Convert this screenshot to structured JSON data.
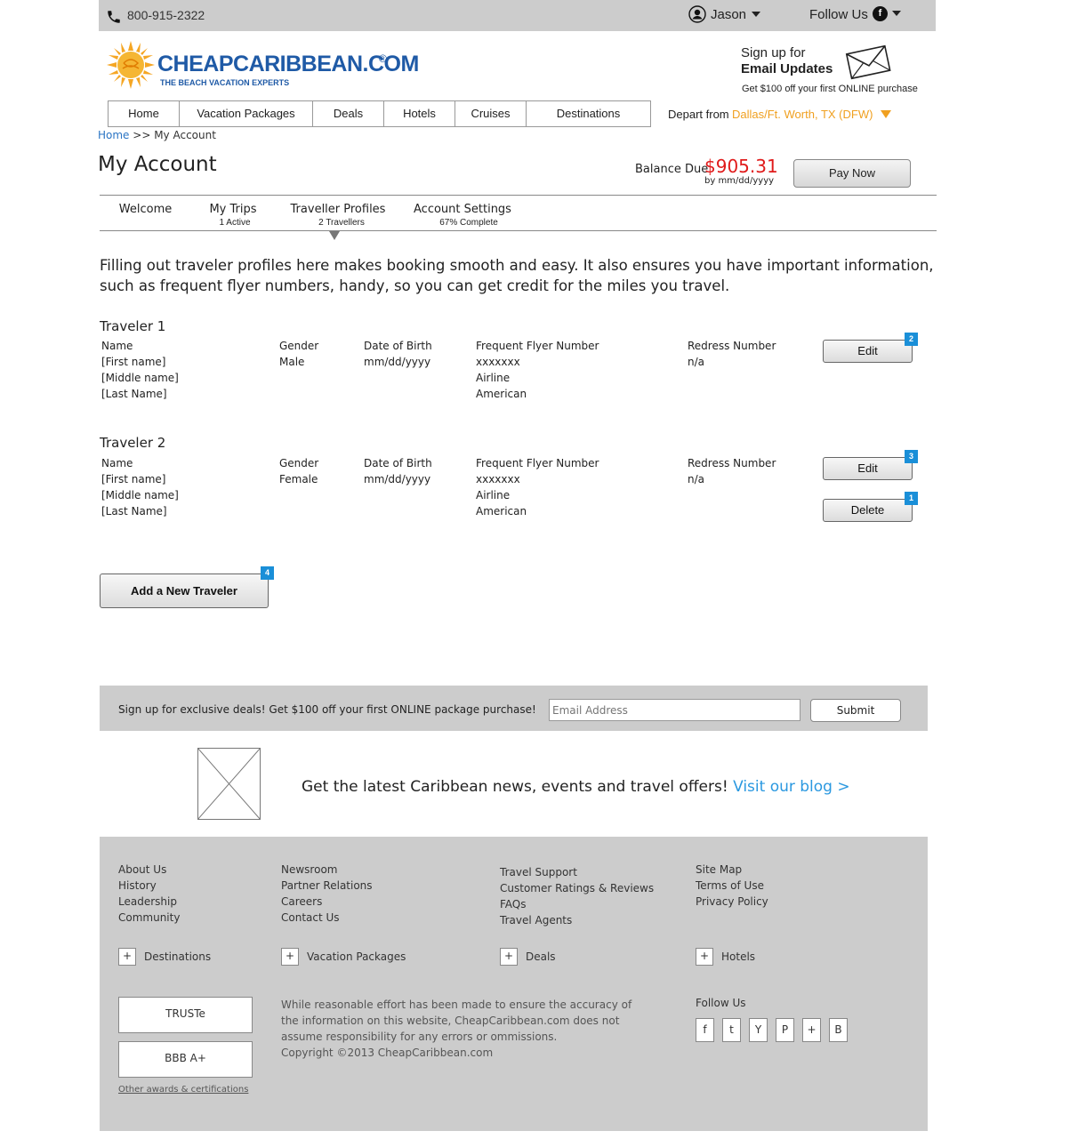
{
  "topbar": {
    "phone": "800-915-2322",
    "user_name": "Jason",
    "follow_label": "Follow Us"
  },
  "logo": {
    "name": "CHEAPCARIBBEAN.COM",
    "registered": "®",
    "tagline": "THE BEACH VACATION EXPERTS"
  },
  "email_promo": {
    "line1": "Sign up for",
    "line2": "Email Updates",
    "sub": "Get $100 off your first ONLINE purchase"
  },
  "nav": {
    "items": [
      "Home",
      "Vacation Packages",
      "Deals",
      "Hotels",
      "Cruises",
      "Destinations"
    ],
    "depart_label": "Depart from",
    "depart_city": "Dallas/Ft. Worth, TX (DFW)"
  },
  "breadcrumb": {
    "home": "Home",
    "separator": ">>",
    "current": "My Account"
  },
  "page_title": "My Account",
  "balance": {
    "label": "Balance Due",
    "amount": "$905.31",
    "due": "by mm/dd/yyyy",
    "pay_label": "Pay Now"
  },
  "account_tabs": [
    {
      "label": "Welcome",
      "sub": ""
    },
    {
      "label": "My Trips",
      "sub": "1 Active"
    },
    {
      "label": "Traveller Profiles",
      "sub": "2 Travellers"
    },
    {
      "label": "Account Settings",
      "sub": "67% Complete"
    }
  ],
  "intro": "Filling out traveler profiles here makes booking smooth and easy. It also ensures you have important information, such as frequent flyer numbers, handy, so you can get credit for the miles you travel.",
  "columns": {
    "name": "Name",
    "gender": "Gender",
    "dob": "Date of Birth",
    "ff": "Frequent Flyer Number",
    "redress": "Redress Number"
  },
  "travelers": [
    {
      "title": "Traveler 1",
      "first": "[First name]",
      "middle": "[Middle name]",
      "last": "[Last Name]",
      "gender": "Male",
      "dob": "mm/dd/yyyy",
      "ff_number": "xxxxxxx",
      "ff_airline_label": "Airline",
      "ff_airline": "American",
      "redress": "n/a",
      "edit_label": "Edit",
      "edit_badge": "2"
    },
    {
      "title": "Traveler 2",
      "first": "[First name]",
      "middle": "[Middle name]",
      "last": "[Last Name]",
      "gender": "Female",
      "dob": "mm/dd/yyyy",
      "ff_number": "xxxxxxx",
      "ff_airline_label": "Airline",
      "ff_airline": "American",
      "redress": "n/a",
      "edit_label": "Edit",
      "edit_badge": "3",
      "delete_label": "Delete",
      "delete_badge": "1"
    }
  ],
  "add_traveler": {
    "label": "Add a New Traveler",
    "badge": "4"
  },
  "newsletter": {
    "text": "Sign up for exclusive deals! Get $100 off your first ONLINE package purchase!",
    "placeholder": "Email Address",
    "submit": "Submit"
  },
  "blog": {
    "text": "Get the latest Caribbean news, events and travel offers!",
    "link": "Visit our blog >"
  },
  "footer": {
    "col1": [
      "About Us",
      "History",
      "Leadership",
      "Community"
    ],
    "col2": [
      "Newsroom",
      "Partner Relations",
      "Careers",
      "Contact Us"
    ],
    "col3": [
      "Travel Support",
      "Customer Ratings & Reviews",
      "FAQs",
      "Travel Agents"
    ],
    "col4": [
      "Site Map",
      "Terms of Use",
      "Privacy Policy"
    ],
    "expand_symbol": "+",
    "sections": [
      "Destinations",
      "Vacation Packages",
      "Deals",
      "Hotels"
    ],
    "awards": [
      "TRUSTe",
      "BBB A+"
    ],
    "awards_link": "Other awards & certifications",
    "disclaimer": "While reasonable effort has been made to ensure the accuracy of the information on this website, CheapCaribbean.com does not assume responsibility for any errors or ommissions.",
    "copyright": "Copyright ©2013 CheapCaribbean.com",
    "follow_label": "Follow Us",
    "social": [
      "f",
      "t",
      "Y",
      "P",
      "+",
      "B"
    ]
  },
  "colors": {
    "accent_blue": "#1a8fd8",
    "link_blue": "#2a74c4",
    "price_red": "#e01b1b",
    "depart_orange": "#f0a020",
    "band_gray": "#cccccc"
  }
}
